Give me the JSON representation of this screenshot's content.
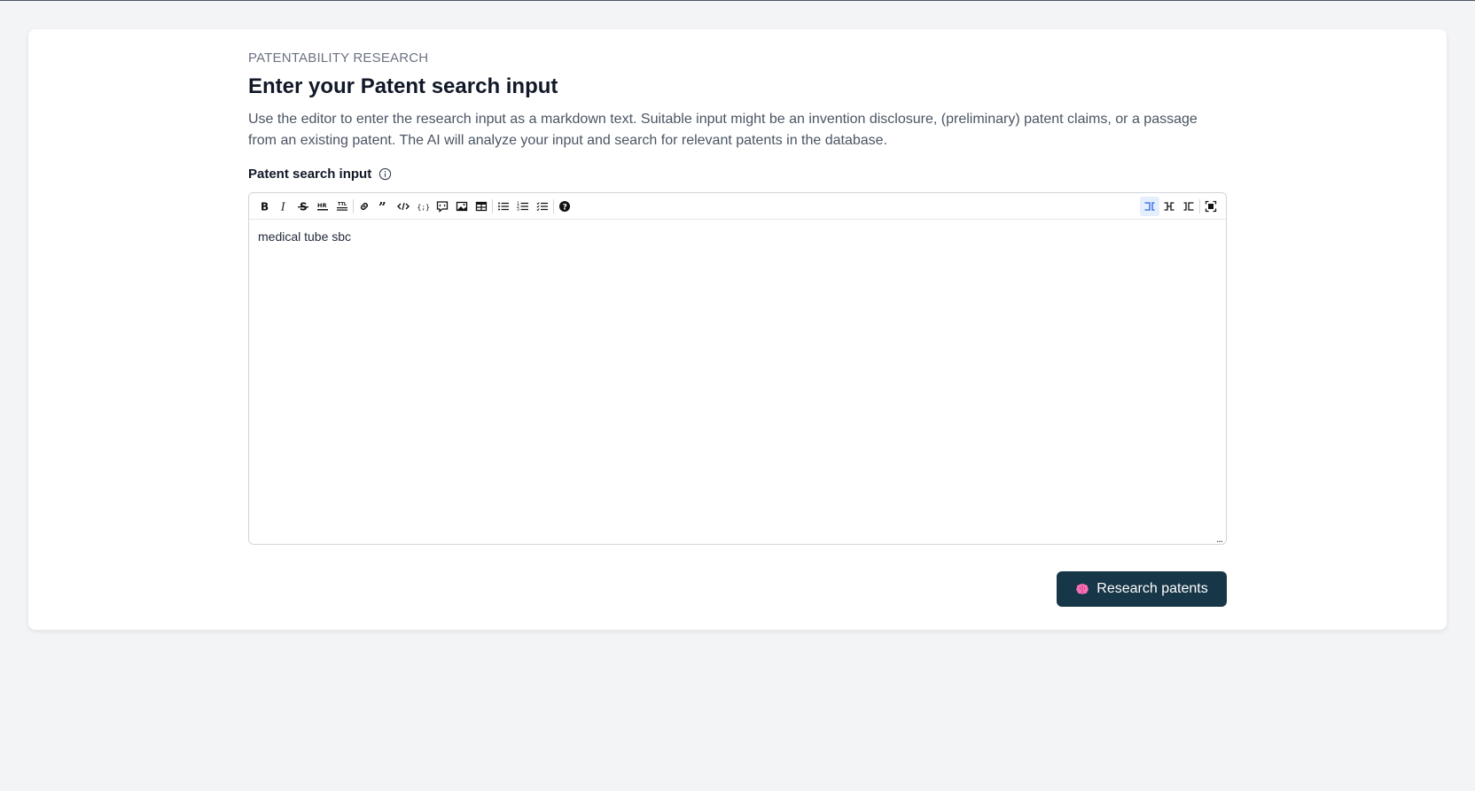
{
  "header": {
    "eyebrow": "PATENTABILITY RESEARCH",
    "title": "Enter your Patent search input",
    "description": "Use the editor to enter the research input as a markdown text. Suitable input might be an invention disclosure, (preliminary) patent claims, or a passage from an existing patent. The AI will analyze your input and search for relevant patents in the database."
  },
  "field": {
    "label": "Patent search input",
    "info_icon": "info-circle-icon"
  },
  "editor": {
    "content": "medical tube sbc",
    "toolbar_left": [
      {
        "name": "bold",
        "icon": "bold-icon",
        "glyph": "B"
      },
      {
        "name": "italic",
        "icon": "italic-icon",
        "glyph": "I"
      },
      {
        "name": "strikethrough",
        "icon": "strikethrough-icon",
        "glyph": "S"
      },
      {
        "name": "hr",
        "icon": "horizontal-rule-icon",
        "glyph": "HR"
      },
      {
        "name": "title",
        "icon": "title-icon",
        "glyph": "T"
      },
      {
        "name": "link",
        "icon": "link-icon",
        "glyph": ""
      },
      {
        "name": "quote",
        "icon": "quote-icon",
        "glyph": "❞"
      },
      {
        "name": "code",
        "icon": "code-icon",
        "glyph": "</>"
      },
      {
        "name": "code-block",
        "icon": "code-block-icon",
        "glyph": "{;}"
      },
      {
        "name": "comment",
        "icon": "comment-icon",
        "glyph": ""
      },
      {
        "name": "image",
        "icon": "image-icon",
        "glyph": ""
      },
      {
        "name": "table",
        "icon": "table-icon",
        "glyph": ""
      },
      {
        "name": "unordered-list",
        "icon": "unordered-list-icon",
        "glyph": ""
      },
      {
        "name": "ordered-list",
        "icon": "ordered-list-icon",
        "glyph": ""
      },
      {
        "name": "checked-list",
        "icon": "checked-list-icon",
        "glyph": ""
      },
      {
        "name": "help",
        "icon": "help-icon",
        "glyph": "?"
      }
    ],
    "toolbar_right": [
      {
        "name": "edit-mode",
        "icon": "edit-mode-icon",
        "active": true
      },
      {
        "name": "live-mode",
        "icon": "live-mode-icon",
        "active": false
      },
      {
        "name": "preview-mode",
        "icon": "preview-mode-icon",
        "active": false
      },
      {
        "name": "fullscreen",
        "icon": "fullscreen-icon",
        "active": false
      }
    ],
    "resize_handle": "..."
  },
  "actions": {
    "research_label": "Research patents",
    "research_icon": "brain-icon"
  },
  "colors": {
    "primary_button": "#173647",
    "active_toolbar": "#2563eb",
    "page_bg": "#f3f4f6"
  }
}
